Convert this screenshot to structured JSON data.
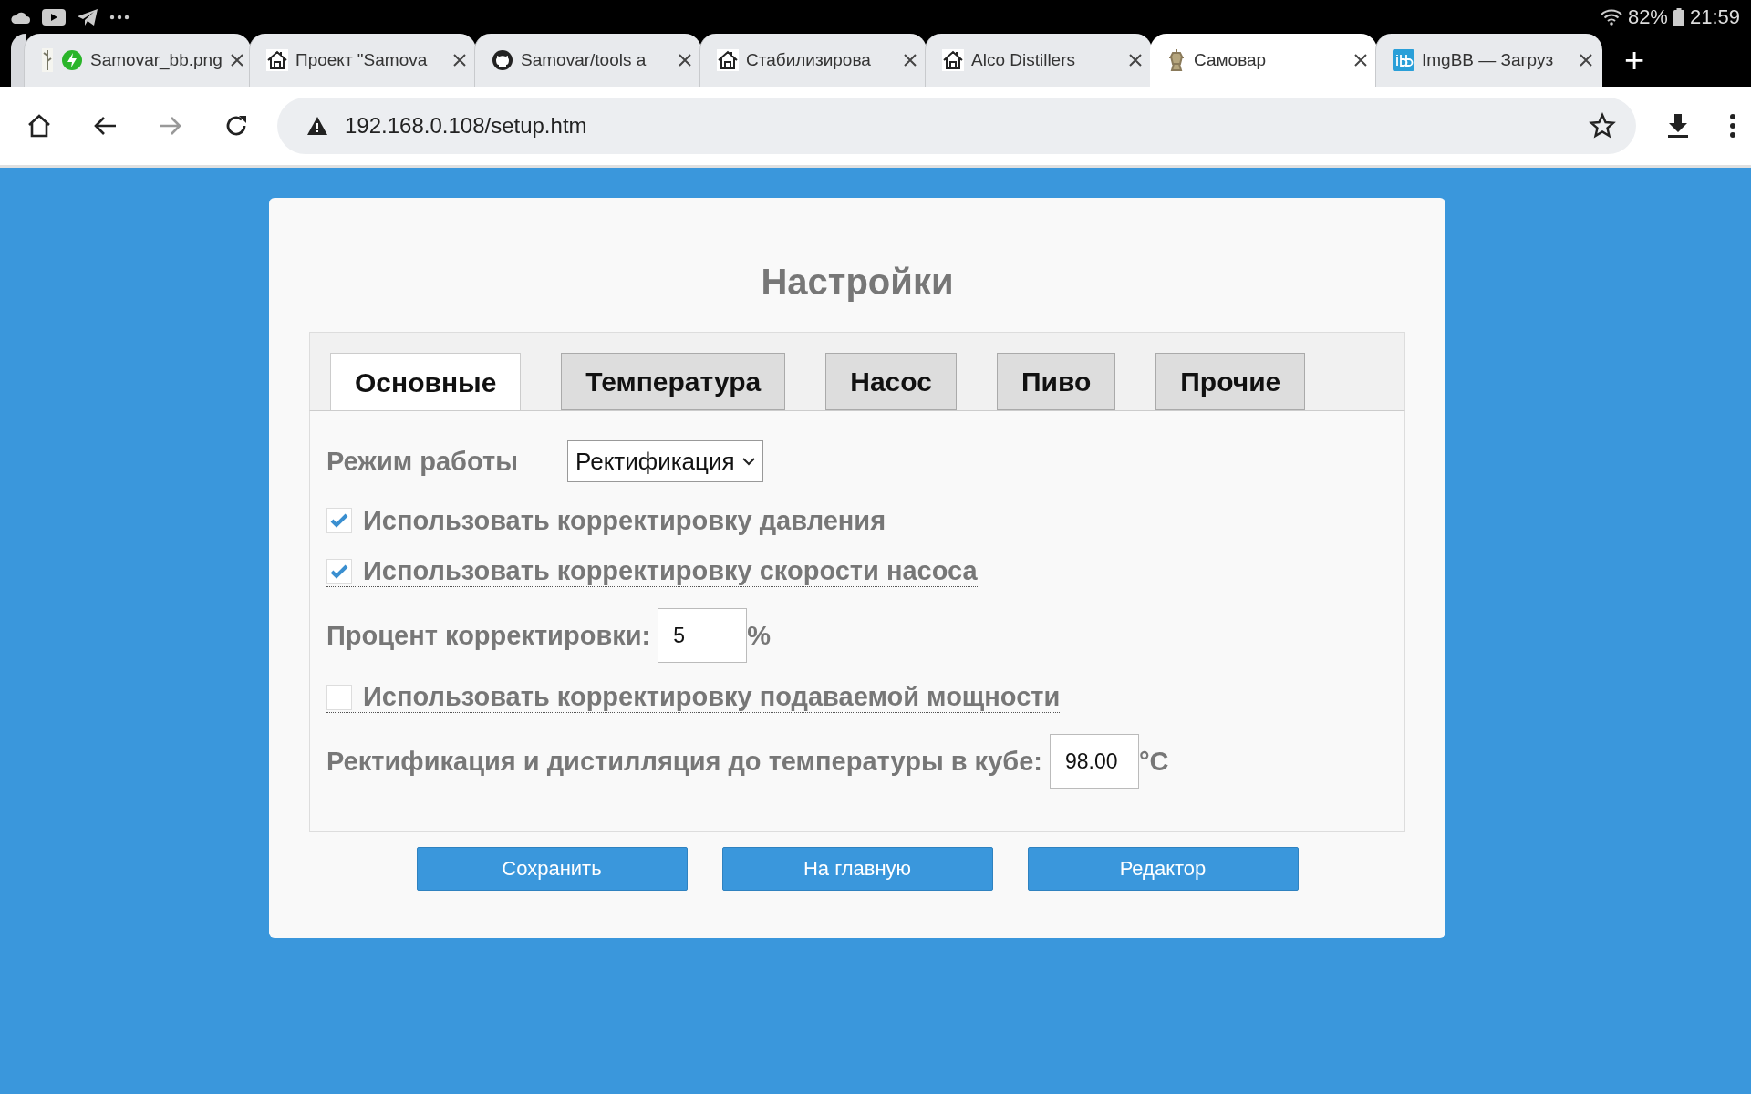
{
  "status_bar": {
    "battery": "82%",
    "time": "21:59"
  },
  "browser_tabs": [
    {
      "title": "Samovar_bb.png",
      "kind": "bolt",
      "selected": false
    },
    {
      "title": "Проект \"Samova",
      "kind": "house",
      "selected": false
    },
    {
      "title": "Samovar/tools a",
      "kind": "github",
      "selected": false
    },
    {
      "title": "Стабилизирова",
      "kind": "house",
      "selected": false
    },
    {
      "title": "Alco Distillers",
      "kind": "house",
      "selected": false
    },
    {
      "title": "Самовар",
      "kind": "samovar",
      "selected": true
    },
    {
      "title": "ImgBB — Загруз",
      "kind": "ibb",
      "selected": false
    }
  ],
  "new_tab": "+",
  "toolbar": {
    "nav": [
      {
        "kind": "home",
        "disabled": false
      },
      {
        "kind": "back",
        "disabled": false
      },
      {
        "kind": "forward",
        "disabled": true
      },
      {
        "kind": "reload",
        "disabled": false
      }
    ],
    "url": "192.168.0.108/setup.htm"
  },
  "page": {
    "title": "Настройки",
    "tabs": [
      {
        "label": "Основные",
        "selected": true
      },
      {
        "label": "Температура",
        "selected": false
      },
      {
        "label": "Насос",
        "selected": false
      },
      {
        "label": "Пиво",
        "selected": false
      },
      {
        "label": "Прочие",
        "selected": false
      }
    ],
    "settings": [
      {
        "kind": "select",
        "label": "Режим работы",
        "value": "Ректификация"
      },
      {
        "kind": "checkbox",
        "label": "Использовать корректировку давления",
        "checked": true,
        "hint": false
      },
      {
        "kind": "checkbox",
        "label": "Использовать корректировку скорости насоса",
        "checked": true,
        "hint": true
      },
      {
        "kind": "number",
        "label": "Процент корректировки:",
        "value": "5",
        "unit": "%"
      },
      {
        "kind": "checkbox",
        "label": "Использовать корректировку подаваемой мощности",
        "checked": false,
        "hint": true
      },
      {
        "kind": "number",
        "label": "Ректификация и дистилляция до температуры в кубе:",
        "value": "98.00",
        "unit": "°C"
      }
    ],
    "buttons": [
      "Сохранить",
      "На главную",
      "Редактор"
    ]
  }
}
